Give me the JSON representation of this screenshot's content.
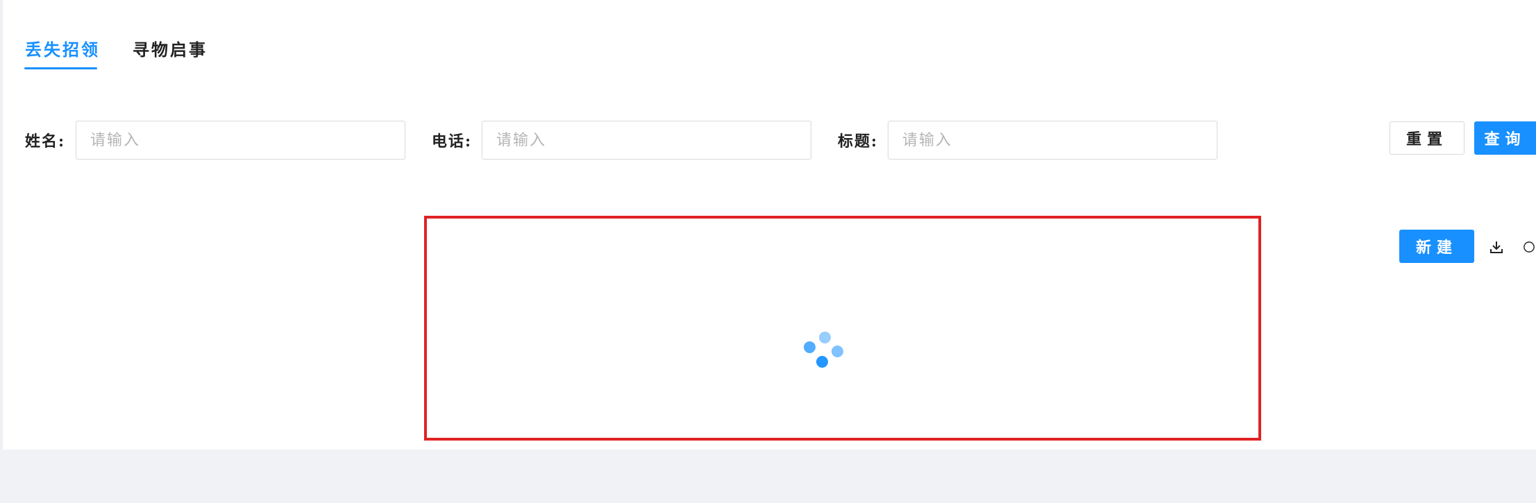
{
  "tabs": [
    {
      "label": "丢失招领",
      "active": true
    },
    {
      "label": "寻物启事",
      "active": false
    }
  ],
  "filters": {
    "name_label": "姓名:",
    "phone_label": "电话:",
    "title_label": "标题:",
    "name_placeholder": "请输入",
    "phone_placeholder": "请输入",
    "title_placeholder": "请输入"
  },
  "actions": {
    "reset_label": "重置",
    "query_label": "查询",
    "new_label": "新建"
  },
  "icons": [
    "download-icon",
    "refresh-icon",
    "loading-spinner"
  ],
  "colors": {
    "accent": "#1890ff",
    "highlight_border": "#e02222",
    "page_bg": "#f0f2f5"
  }
}
